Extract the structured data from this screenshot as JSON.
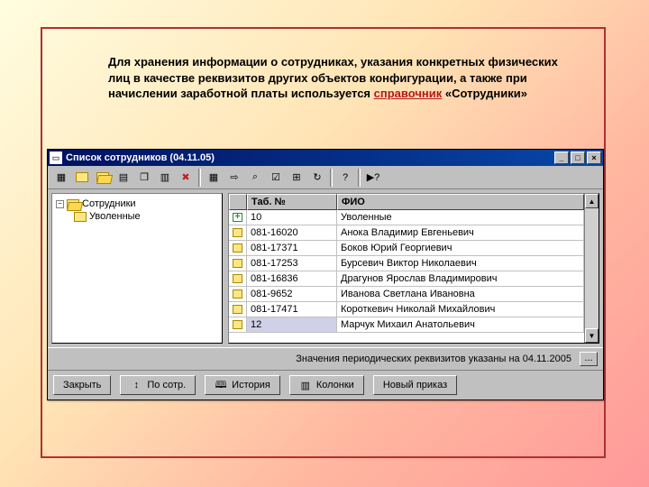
{
  "intro": {
    "t1": "Для хранения информации о сотрудниках, указания конкретных физических лиц в качестве реквизитов других объектов конфигурации, а также при начислении заработной платы используется ",
    "t2": "справочник",
    "t3": "  «Сотрудники»"
  },
  "window": {
    "title": "Список сотрудников (04.11.05)"
  },
  "tree": {
    "root": "Сотрудники",
    "child": "Уволенные"
  },
  "grid": {
    "col0": "",
    "col1": "Таб. №",
    "col2": "ФИО",
    "rows": [
      {
        "kind": "plus",
        "num": "10",
        "name": "Уволенные"
      },
      {
        "kind": "f",
        "num": "081-16020",
        "name": "Анока Владимир Евгеньевич"
      },
      {
        "kind": "f",
        "num": "081-17371",
        "name": "Боков Юрий Георгиевич"
      },
      {
        "kind": "f",
        "num": "081-17253",
        "name": "Бурсевич Виктор Николаевич"
      },
      {
        "kind": "f",
        "num": "081-16836",
        "name": "Драгунов Ярослав Владимирович"
      },
      {
        "kind": "f",
        "num": "081-9652",
        "name": "Иванова Светлана Ивановна"
      },
      {
        "kind": "f",
        "num": "081-17471",
        "name": "Короткевич  Николай Михайлович"
      },
      {
        "kind": "f",
        "num": "12",
        "name": "Марчук Михаил Анатольевич",
        "sel": true
      }
    ]
  },
  "status": {
    "text": "Значения периодических реквизитов указаны на 04.11.2005",
    "dots": "..."
  },
  "footer": {
    "close": "Закрыть",
    "sort": "По сотр.",
    "history": "История",
    "columns": "Колонки",
    "neworder": "Новый приказ"
  },
  "glyph": {
    "min": "_",
    "max": "□",
    "close": "×",
    "plus": "+",
    "minus": "−",
    "up": "▲",
    "down": "▼",
    "q": "?",
    "qa": "▶?"
  }
}
